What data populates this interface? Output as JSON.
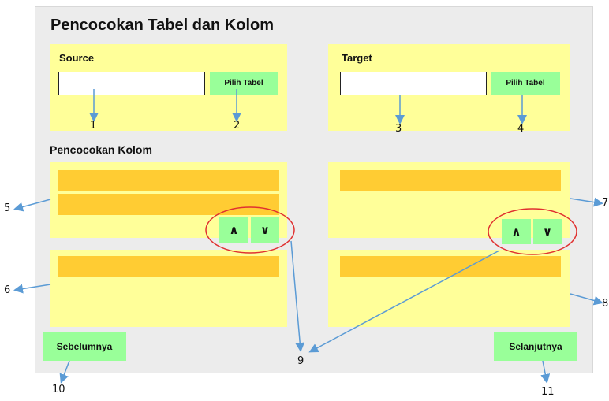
{
  "title": "Pencocokan Tabel dan Kolom",
  "source": {
    "label": "Source",
    "input_value": "",
    "button": "Pilih Tabel"
  },
  "target": {
    "label": "Target",
    "input_value": "",
    "button": "Pilih Tabel"
  },
  "section_title": "Pencocokan Kolom",
  "move_up": "∧",
  "move_down": "∨",
  "prev_button": "Sebelumnya",
  "next_button": "Selanjutnya",
  "callouts": [
    "1",
    "2",
    "3",
    "4",
    "5",
    "6",
    "7",
    "8",
    "9",
    "10",
    "11"
  ],
  "colors": {
    "panel": "#ffff99",
    "button": "#99ff99",
    "row_highlight": "#ffcc33",
    "callout_arrow": "#5b9bd5",
    "callout_circle": "#e03030"
  }
}
